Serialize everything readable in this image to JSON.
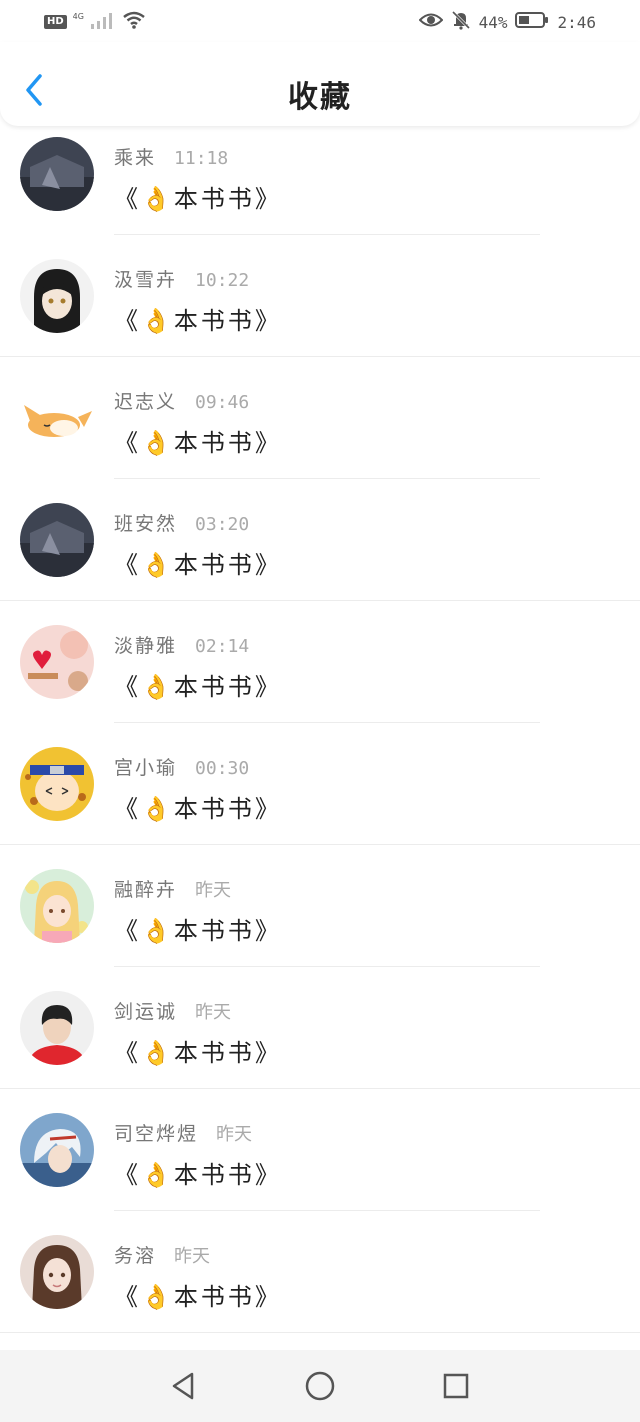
{
  "status_bar": {
    "hd_label": "HD",
    "network_label": "4G",
    "battery_percent": "44%",
    "battery_level": 0.44,
    "time": "2:46",
    "icons": [
      "signal-icon",
      "wifi-icon",
      "eye-icon",
      "mute-bell-icon",
      "battery-icon"
    ]
  },
  "header": {
    "title": "收藏",
    "back_icon": "chevron-left-icon",
    "accent_color": "#2196f3"
  },
  "favorites": [
    {
      "name": "乘来",
      "time": "11:18",
      "content": "《👌本书书》",
      "avatar": "dark-scene-avatar"
    },
    {
      "name": "汲雪卉",
      "time": "10:22",
      "content": "《👌本书书》",
      "avatar": "anime-boy-avatar"
    },
    {
      "name": "迟志义",
      "time": "09:46",
      "content": "《👌本书书》",
      "avatar": "sleeping-fox-avatar"
    },
    {
      "name": "班安然",
      "time": "03:20",
      "content": "《👌本书书》",
      "avatar": "dark-scene-avatar"
    },
    {
      "name": "淡静雅",
      "time": "02:14",
      "content": "《👌本书书》",
      "avatar": "heart-avatar"
    },
    {
      "name": "宫小瑜",
      "time": "00:30",
      "content": "《👌本书书》",
      "avatar": "ninja-avatar"
    },
    {
      "name": "融醉卉",
      "time": "昨天",
      "content": "《👌本书书》",
      "avatar": "blonde-girl-avatar"
    },
    {
      "name": "剑运诚",
      "time": "昨天",
      "content": "《👌本书书》",
      "avatar": "red-shirt-boy-avatar"
    },
    {
      "name": "司空烨煜",
      "time": "昨天",
      "content": "《👌本书书》",
      "avatar": "white-hair-avatar"
    },
    {
      "name": "务溶",
      "time": "昨天",
      "content": "《👌本书书》",
      "avatar": "brown-hair-girl-avatar"
    }
  ],
  "nav_bar": {
    "buttons": [
      "back-triangle-icon",
      "home-circle-icon",
      "recents-square-icon"
    ]
  }
}
